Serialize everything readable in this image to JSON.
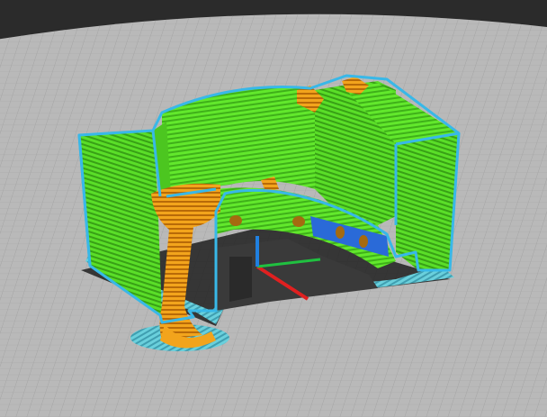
{
  "viewport": {
    "background": "#2b2b2b",
    "bed_color": "#b9b9b9",
    "bed_grid_color": "#9d9d9d"
  },
  "colors": {
    "perimeter": "#38b8e8",
    "infill": "#5ee62a",
    "infill_dark": "#3aa818",
    "support": "#f0a018",
    "support_dark": "#b86c0a",
    "skirt": "#5ec8d8",
    "shadow": "#1e1e1e",
    "axis_x": "#e02020",
    "axis_y": "#20c040",
    "axis_z": "#2080e0"
  },
  "icons": {
    "axis_gizmo": "xyz-axes-icon"
  }
}
